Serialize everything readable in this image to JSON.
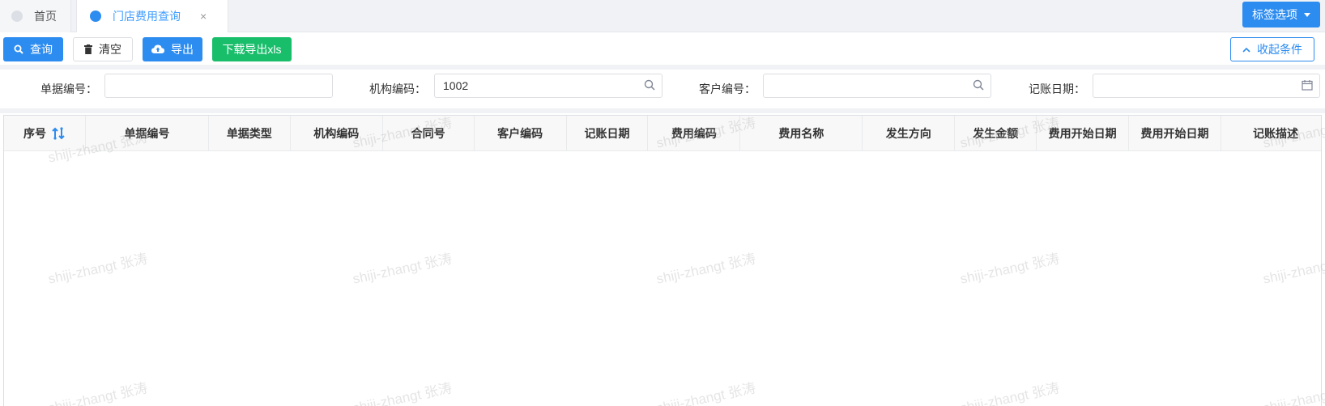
{
  "tabs": {
    "home": "首页",
    "active": "门店费用查询",
    "close": "×",
    "options": "标签选项"
  },
  "toolbar": {
    "query": "查询",
    "clear": "清空",
    "export": "导出",
    "download_xls": "下载导出xls",
    "collapse": "收起条件"
  },
  "filters": {
    "doc_no": {
      "label": "单据编号：",
      "value": ""
    },
    "org_code": {
      "label": "机构编码：",
      "value": "1002"
    },
    "customer_no": {
      "label": "客户编号：",
      "value": ""
    },
    "post_date": {
      "label": "记账日期：",
      "value": ""
    }
  },
  "table": {
    "columns": [
      "序号",
      "单据编号",
      "单据类型",
      "机构编码",
      "合同号",
      "客户编码",
      "记账日期",
      "费用编码",
      "费用名称",
      "发生方向",
      "发生金额",
      "费用开始日期",
      "费用开始日期",
      "记账描述"
    ],
    "rows": []
  },
  "watermark": "shiji-zhangt 张涛",
  "colors": {
    "primary": "#2d8cf0",
    "success": "#19be6b",
    "header_bg": "#f8f8f9"
  }
}
